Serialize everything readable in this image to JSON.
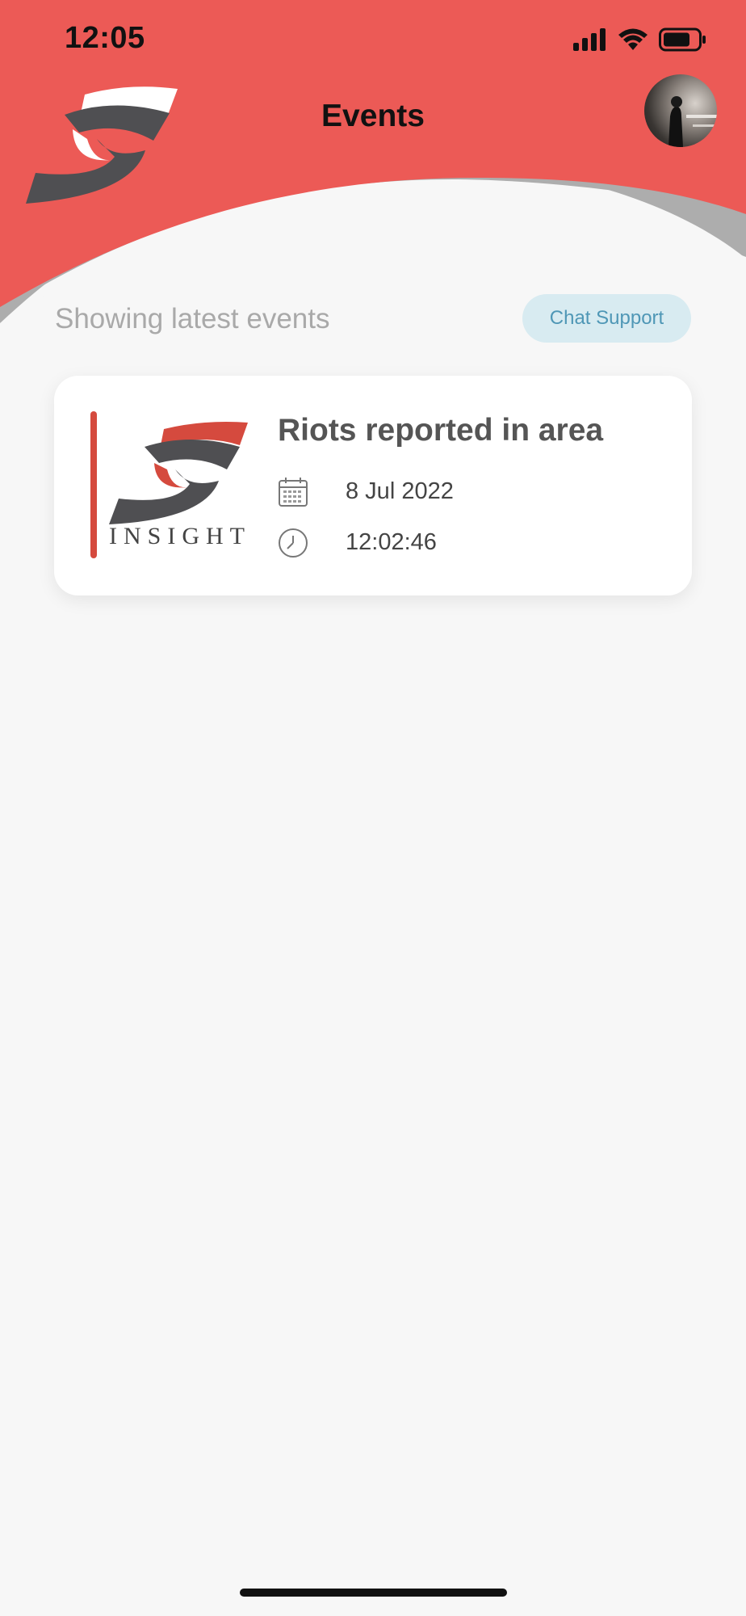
{
  "status_bar": {
    "time": "12:05",
    "icons": [
      "signal-icon",
      "wifi-icon",
      "battery-icon"
    ]
  },
  "header": {
    "title": "Events",
    "logo_icon": "insight-eye-logo",
    "avatar_icon": "user-avatar"
  },
  "feed": {
    "subtitle": "Showing latest events",
    "chat_support_label": "Chat Support"
  },
  "events": [
    {
      "title": "Riots reported in area",
      "logo_text": "INSIGHT",
      "date": "8 Jul 2022",
      "time": "12:02:46",
      "date_icon": "calendar-icon",
      "time_icon": "clock-icon"
    }
  ],
  "colors": {
    "header_red": "#ec5a56",
    "header_swoosh_grey": "#adadad",
    "background": "#f7f7f7",
    "accent_bar": "#d54a3e",
    "chat_button_bg": "#d8ebf1",
    "chat_button_text": "#4f97b6"
  }
}
